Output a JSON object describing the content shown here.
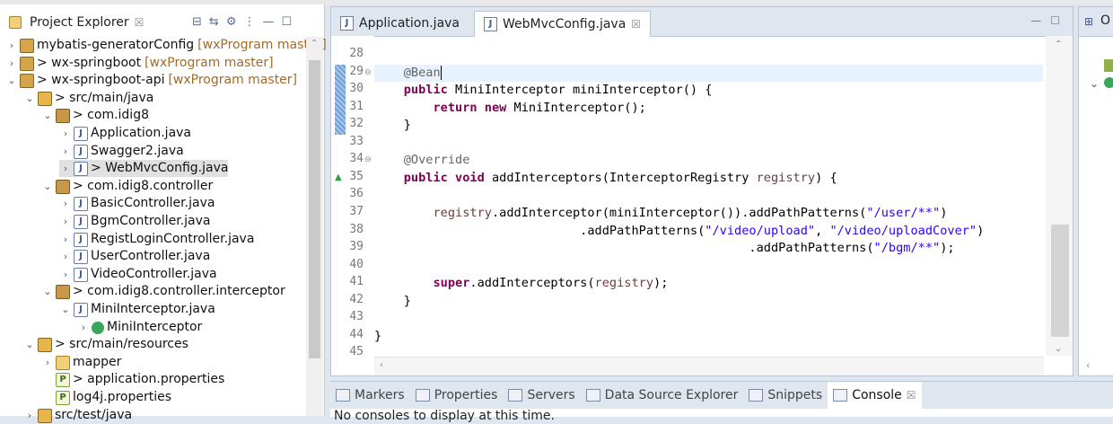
{
  "project_explorer": {
    "title": "Project Explorer",
    "close": "☒",
    "tree": [
      {
        "arrow": "›",
        "icon": "proj",
        "label": "mybatis-generatorConfig",
        "extra": "[wxProgram master]",
        "indent": 0
      },
      {
        "arrow": "›",
        "icon": "proj",
        "label": "> wx-springboot",
        "extra": "[wxProgram master]",
        "indent": 0
      },
      {
        "arrow": "⌄",
        "icon": "proj",
        "label": "> wx-springboot-api",
        "extra": "[wxProgram master]",
        "indent": 0
      },
      {
        "arrow": "⌄",
        "icon": "src",
        "label": "> src/main/java",
        "extra": "",
        "indent": 1
      },
      {
        "arrow": "⌄",
        "icon": "pkg",
        "label": "> com.idig8",
        "extra": "",
        "indent": 2
      },
      {
        "arrow": "›",
        "icon": "java",
        "label": "Application.java",
        "extra": "",
        "indent": 3
      },
      {
        "arrow": "›",
        "icon": "java",
        "label": "Swagger2.java",
        "extra": "",
        "indent": 3
      },
      {
        "arrow": "›",
        "icon": "java",
        "label": "> WebMvcConfig.java",
        "extra": "",
        "indent": 3,
        "selected": true
      },
      {
        "arrow": "⌄",
        "icon": "pkg",
        "label": "> com.idig8.controller",
        "extra": "",
        "indent": 2
      },
      {
        "arrow": "›",
        "icon": "java",
        "label": "BasicController.java",
        "extra": "",
        "indent": 3
      },
      {
        "arrow": "›",
        "icon": "java",
        "label": "BgmController.java",
        "extra": "",
        "indent": 3
      },
      {
        "arrow": "›",
        "icon": "java",
        "label": "RegistLoginController.java",
        "extra": "",
        "indent": 3
      },
      {
        "arrow": "›",
        "icon": "java",
        "label": "UserController.java",
        "extra": "",
        "indent": 3
      },
      {
        "arrow": "›",
        "icon": "java",
        "label": "VideoController.java",
        "extra": "",
        "indent": 3
      },
      {
        "arrow": "⌄",
        "icon": "pkg",
        "label": "> com.idig8.controller.interceptor",
        "extra": "",
        "indent": 2
      },
      {
        "arrow": "⌄",
        "icon": "java",
        "label": "MiniInterceptor.java",
        "extra": "",
        "indent": 3
      },
      {
        "arrow": "›",
        "icon": "cls",
        "label": "MiniInterceptor",
        "extra": "",
        "indent": 4
      },
      {
        "arrow": "⌄",
        "icon": "src",
        "label": "> src/main/resources",
        "extra": "",
        "indent": 1
      },
      {
        "arrow": "›",
        "icon": "folder",
        "label": "mapper",
        "extra": "",
        "indent": 2
      },
      {
        "arrow": "",
        "icon": "prop",
        "label": "> application.properties",
        "extra": "",
        "indent": 2
      },
      {
        "arrow": "",
        "icon": "prop",
        "label": "log4j.properties",
        "extra": "",
        "indent": 2
      },
      {
        "arrow": "›",
        "icon": "src",
        "label": "src/test/java",
        "extra": "",
        "indent": 1
      }
    ]
  },
  "editor": {
    "tabs": [
      {
        "label": "Application.java",
        "active": false
      },
      {
        "label": "WebMvcConfig.java",
        "active": true,
        "close": "☒"
      }
    ],
    "line_numbers": [
      "28",
      "29",
      "30",
      "31",
      "32",
      "33",
      "34",
      "35",
      "36",
      "37",
      "38",
      "39",
      "40",
      "41",
      "42",
      "43",
      "44",
      "45"
    ]
  },
  "outline_tab": "O",
  "bottom_panel": {
    "tabs": [
      {
        "label": "Markers",
        "active": false
      },
      {
        "label": "Properties",
        "active": false
      },
      {
        "label": "Servers",
        "active": false
      },
      {
        "label": "Data Source Explorer",
        "active": false
      },
      {
        "label": "Snippets",
        "active": false
      },
      {
        "label": "Console",
        "active": true,
        "close": "☒"
      }
    ],
    "console_text": "No consoles to display at this time."
  }
}
